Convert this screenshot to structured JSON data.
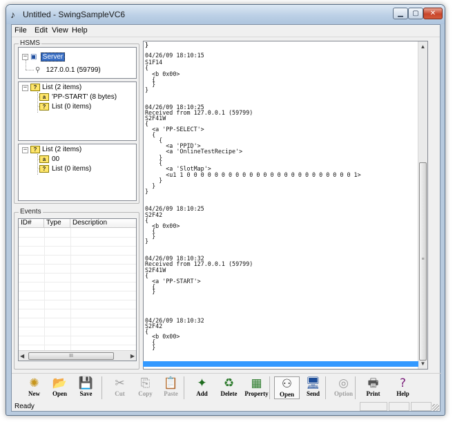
{
  "window": {
    "title": "Untitled - SwingSampleVC6"
  },
  "menu": [
    "File",
    "Edit",
    "View",
    "Help"
  ],
  "hsms": {
    "label": "HSMS",
    "tree1": {
      "server": "Server",
      "address": "127.0.0.1 (59799)"
    },
    "tree2": {
      "list": "List (2 items)",
      "ascii": "'PP-START' (8 bytes)",
      "ascii_icon": "a",
      "sublist": "List (0 items)"
    },
    "tree3": {
      "list": "List (2 items)",
      "binary": "00",
      "binary_icon": "a",
      "sublist": "List (0 items)"
    }
  },
  "events": {
    "label": "Events",
    "columns": [
      "ID#",
      "Type",
      "Description"
    ],
    "hscroll_thumb": "III"
  },
  "log": [
    "04/26/09 18:10:15",
    "S1F14",
    "{",
    "  <b 0x00>",
    "  {",
    "  }",
    "}",
    "",
    "04/26/09 18:10:25",
    "Received from 127.0.0.1 (59799)",
    "S2F41W",
    "{",
    "  <a 'PP-SELECT'>",
    "  {",
    "    {",
    "      <a 'PPID'>",
    "      <a 'OnlineTestRecipe'>",
    "    }",
    "    {",
    "      <a 'SlotMap'>",
    "      <u1 1 0 0 0 0 0 0 0 0 0 0 0 0 0 0 0 0 0 0 0 0 0 0 0 0 1>",
    "    }",
    "  }",
    "}",
    "",
    "04/26/09 18:10:25",
    "S2F42",
    "{",
    "  <b 0x00>",
    "  {",
    "  }",
    "}",
    "",
    "04/26/09 18:10:32",
    "Received from 127.0.0.1 (59799)",
    "S2F41W",
    "{",
    "  <a 'PP-START'>",
    "  {",
    "  }",
    "}",
    "",
    "04/26/09 18:10:32",
    "S2F42",
    "{",
    "  <b 0x00>",
    "  {",
    "  }",
    "}"
  ],
  "toolbar": [
    {
      "label": "New",
      "icon": "new-icon",
      "glyph": "✺",
      "enabled": true
    },
    {
      "label": "Open",
      "icon": "open-folder-icon",
      "glyph": "📂",
      "enabled": true
    },
    {
      "label": "Save",
      "icon": "save-disk-icon",
      "glyph": "💾",
      "enabled": true
    },
    {
      "label": "Cut",
      "icon": "cut-icon",
      "glyph": "✂",
      "enabled": false
    },
    {
      "label": "Copy",
      "icon": "copy-icon",
      "glyph": "⎘",
      "enabled": false
    },
    {
      "label": "Paste",
      "icon": "paste-icon",
      "glyph": "📋",
      "enabled": false
    },
    {
      "label": "Add",
      "icon": "add-wand-icon",
      "glyph": "✦",
      "enabled": true
    },
    {
      "label": "Delete",
      "icon": "delete-recycle-icon",
      "glyph": "♻",
      "enabled": true
    },
    {
      "label": "Property",
      "icon": "property-board-icon",
      "glyph": "▦",
      "enabled": true
    },
    {
      "label": "Open",
      "icon": "open-connection-icon",
      "glyph": "⚇",
      "enabled": true
    },
    {
      "label": "Send",
      "icon": "send-computer-icon",
      "glyph": "🖥",
      "enabled": true
    },
    {
      "label": "Option",
      "icon": "option-disc-icon",
      "glyph": "◎",
      "enabled": false
    },
    {
      "label": "Print",
      "icon": "printer-icon",
      "glyph": "🖶",
      "enabled": true
    },
    {
      "label": "Help",
      "icon": "help-book-icon",
      "glyph": "?",
      "enabled": true
    }
  ],
  "status": {
    "text": "Ready"
  }
}
